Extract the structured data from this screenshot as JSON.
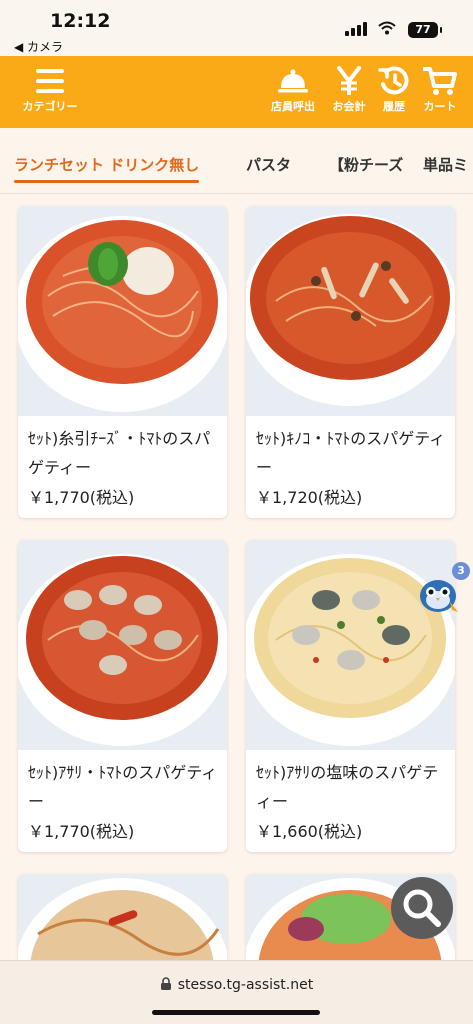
{
  "status": {
    "time": "12:12",
    "back_label": "◀ カメラ",
    "battery": "77"
  },
  "header": {
    "category_label": "カテゴリー",
    "staff_call_label": "店員呼出",
    "checkout_label": "お会計",
    "history_label": "履歴",
    "cart_label": "カート",
    "accent_color": "#fbaa17"
  },
  "tabs": [
    {
      "label": "ランチセット ドリンク無し",
      "active": true
    },
    {
      "label": "パスタ",
      "active": false
    },
    {
      "label": "【粉チーズ",
      "active": false
    },
    {
      "label": "単品ミ",
      "active": false
    }
  ],
  "menu_items": [
    {
      "name": "ｾｯﾄ)糸引ﾁｰｽﾞ・ﾄﾏﾄのスパゲティー",
      "price": "￥1,770(税込)"
    },
    {
      "name": "ｾｯﾄ)ｷﾉｺ・ﾄﾏﾄのスパゲティー",
      "price": "￥1,720(税込)"
    },
    {
      "name": "ｾｯﾄ)ｱｻﾘ・ﾄﾏﾄのスパゲティー",
      "price": "￥1,770(税込)"
    },
    {
      "name": "ｾｯﾄ)ｱｻﾘの塩味のスパゲティー",
      "price": "￥1,660(税込)"
    }
  ],
  "assistant_badge": "3",
  "browser": {
    "url": "stesso.tg-assist.net"
  }
}
